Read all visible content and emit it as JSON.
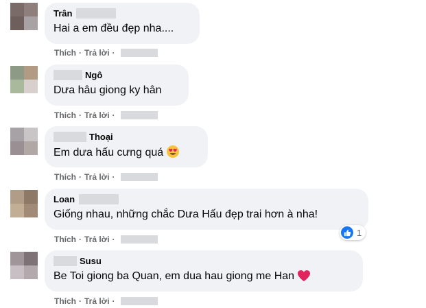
{
  "actions": {
    "like": "Thích",
    "reply": "Trả lời",
    "separator": "·"
  },
  "comments": [
    {
      "name": "Trân",
      "text": "Hai a em đều đẹp nha....",
      "avatar_colors": [
        "#7a6a68",
        "#8f7f7b",
        "#6f5f5c",
        "#a9a2a4"
      ]
    },
    {
      "name": "Ngô",
      "text": "Dưa hâu giong ky hân",
      "avatar_colors": [
        "#8c9a86",
        "#b39a83",
        "#a8ba9b",
        "#d8d0cc"
      ]
    },
    {
      "name": "Thoại",
      "text": "Em dưa hấu cưng quá",
      "emoji": "heart-eyes-emoji",
      "avatar_colors": [
        "#a7a2a6",
        "#c9c4c6",
        "#9a8f92",
        "#b1a7a5"
      ]
    },
    {
      "name": "Loan",
      "text": "Giống nhau, những chắc Dưa Hấu đẹp trai hơn à nha!",
      "avatar_colors": [
        "#b19c87",
        "#8e7866",
        "#c2ad95",
        "#a18a76"
      ],
      "reaction": {
        "icon": "thumbs-up-icon",
        "count": "1",
        "color": "#1877f2"
      }
    },
    {
      "name": "Susu",
      "text": "Be Toi giong ba Quan, em dua hau giong me Han",
      "emoji": "red-heart-emoji",
      "avatar_colors": [
        "#a09598",
        "#7f7276",
        "#c7bfc4",
        "#b3a9ad"
      ]
    }
  ]
}
